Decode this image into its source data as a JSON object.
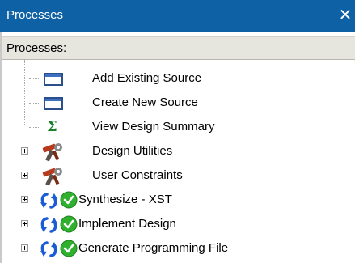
{
  "window": {
    "title": "Processes",
    "close_glyph": "✕"
  },
  "header": {
    "label": "Processes:"
  },
  "tree": {
    "items": [
      {
        "label": "Add Existing Source",
        "icon": "window-icon",
        "expandable": false
      },
      {
        "label": "Create New Source",
        "icon": "window-icon",
        "expandable": false
      },
      {
        "label": "View Design Summary",
        "icon": "sigma-icon",
        "expandable": false
      },
      {
        "label": "Design Utilities",
        "icon": "tools-icon",
        "expandable": true
      },
      {
        "label": "User Constraints",
        "icon": "tools-icon",
        "expandable": true
      },
      {
        "label": "Synthesize - XST",
        "icon": "rerun-icon",
        "status": "check-icon",
        "expandable": true
      },
      {
        "label": "Implement Design",
        "icon": "rerun-icon",
        "status": "check-icon",
        "expandable": true
      },
      {
        "label": "Generate Programming File",
        "icon": "rerun-icon",
        "status": "check-icon",
        "expandable": true
      }
    ]
  },
  "colors": {
    "titlebar": "#0d61a4",
    "header": "#e6e5de",
    "check": "#2fb12f",
    "rerun": "#1a5bd6",
    "tools": "#b8391c"
  }
}
